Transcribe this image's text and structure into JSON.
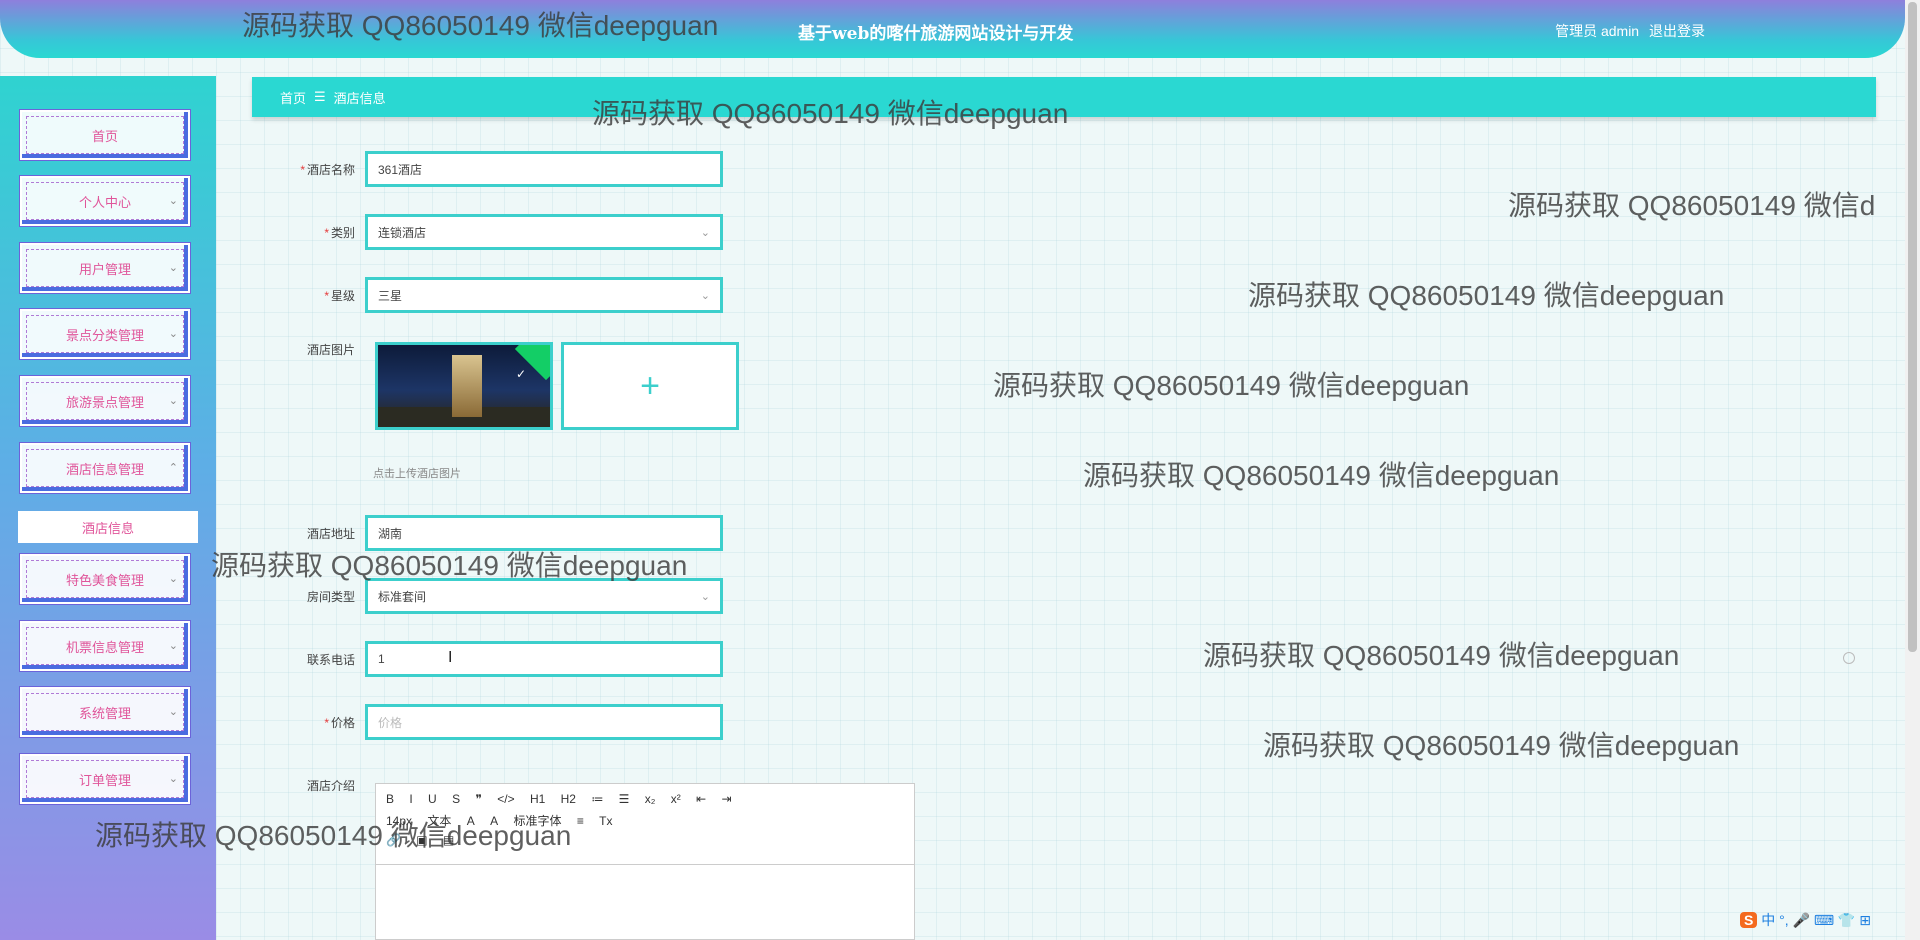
{
  "header": {
    "title": "基于web的喀什旅游网站设计与开发",
    "user_label": "管理员 admin",
    "logout": "退出登录"
  },
  "sidebar": {
    "items": [
      {
        "label": "首页",
        "chevron": ""
      },
      {
        "label": "个人中心",
        "chevron": "⌄"
      },
      {
        "label": "用户管理",
        "chevron": "⌄"
      },
      {
        "label": "景点分类管理",
        "chevron": "⌄"
      },
      {
        "label": "旅游景点管理",
        "chevron": "⌄"
      },
      {
        "label": "酒店信息管理",
        "chevron": "⌃"
      },
      {
        "label": "特色美食管理",
        "chevron": "⌄"
      },
      {
        "label": "机票信息管理",
        "chevron": "⌄"
      },
      {
        "label": "系统管理",
        "chevron": "⌄"
      },
      {
        "label": "订单管理",
        "chevron": "⌄"
      }
    ],
    "sub_item": "酒店信息"
  },
  "breadcrumb": {
    "home": "首页",
    "separator": "☰",
    "current": "酒店信息"
  },
  "form": {
    "hotel_name": {
      "label": "酒店名称",
      "value": "361酒店",
      "required": "*"
    },
    "category": {
      "label": "类别",
      "value": "连锁酒店",
      "required": "*"
    },
    "star": {
      "label": "星级",
      "value": "三星",
      "required": "*"
    },
    "image": {
      "label": "酒店图片",
      "add": "+",
      "tip": "点击上传酒店图片"
    },
    "address": {
      "label": "酒店地址",
      "value": "湖南"
    },
    "room_type": {
      "label": "房间类型",
      "value": "标准套间"
    },
    "phone": {
      "label": "联系电话",
      "value": "1"
    },
    "price": {
      "label": "价格",
      "placeholder": "价格",
      "required": "*"
    },
    "intro": {
      "label": "酒店介绍"
    }
  },
  "editor": {
    "row1": [
      "B",
      "I",
      "U",
      "S",
      "❞",
      "</>",
      "H1",
      "H2",
      "≔",
      "☰",
      "x₂",
      "x²",
      "⇤",
      "⇥"
    ],
    "row2": [
      "14px",
      "文本",
      "A",
      "A",
      "标准字体",
      "≡",
      "Tx"
    ],
    "row3": [
      "🔗",
      "▣",
      "▤"
    ]
  },
  "watermark": "源码获取 QQ86050149 微信deepguan",
  "watermark_cut": "源码获取 QQ86050149 微信d",
  "ime": {
    "logo": "S",
    "lang": "中",
    "icons": "°, 🎤 ⌨ 👕 ⊞"
  }
}
